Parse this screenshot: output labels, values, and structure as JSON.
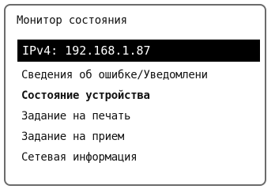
{
  "screen": {
    "title": "Монитор состояния",
    "items": [
      {
        "label": "IPv4: 192.168.1.87",
        "selected": true
      },
      {
        "label": "Сведения об ошибке/Уведомлени",
        "selected": false
      },
      {
        "label": "Состояние устройства",
        "selected": false
      },
      {
        "label": "Задание на печать",
        "selected": false
      },
      {
        "label": "Задание на прием",
        "selected": false
      },
      {
        "label": "Сетевая информация",
        "selected": false
      }
    ]
  },
  "colors": {
    "highlight_bg": "#000000",
    "highlight_text": "#ffffff",
    "border": "#6b6b6b"
  }
}
